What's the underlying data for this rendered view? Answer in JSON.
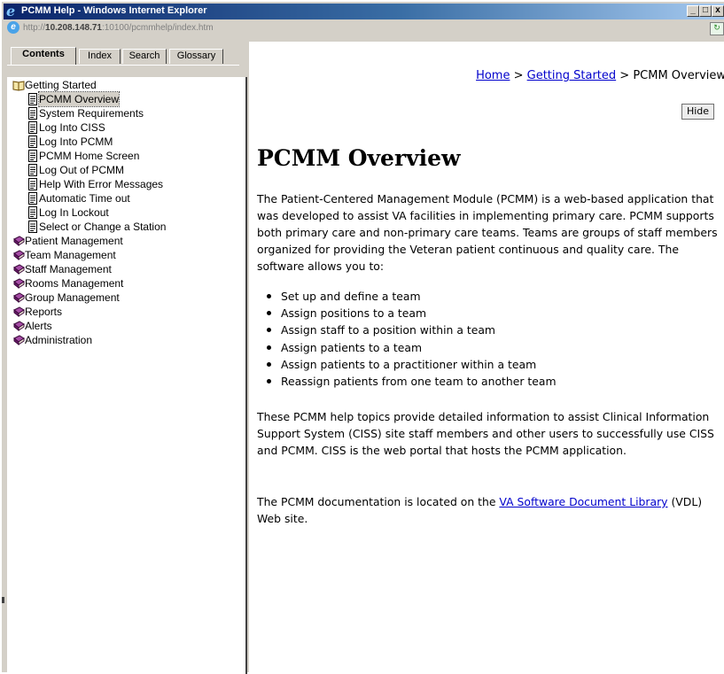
{
  "window": {
    "title": "PCMM Help - Windows Internet Explorer",
    "url_prefix": "http://",
    "url_host": "10.208.148.71",
    "url_rest": ":10100/pcmmhelp/index.htm",
    "minimize_glyph": "_",
    "maximize_glyph": "□",
    "close_glyph": "x"
  },
  "nav": {
    "tabs": [
      {
        "label": "Contents",
        "active": true
      },
      {
        "label": "Index"
      },
      {
        "label": "Search"
      },
      {
        "label": "Glossary"
      }
    ],
    "tree": [
      {
        "label": "Getting Started",
        "icon": "open-book-icon",
        "indent": 0
      },
      {
        "label": "PCMM Overview",
        "icon": "page-icon",
        "indent": 1,
        "selected": true
      },
      {
        "label": "System Requirements",
        "icon": "page-icon",
        "indent": 1
      },
      {
        "label": "Log Into CISS",
        "icon": "page-icon",
        "indent": 1
      },
      {
        "label": "Log Into PCMM",
        "icon": "page-icon",
        "indent": 1
      },
      {
        "label": "PCMM Home Screen",
        "icon": "page-icon",
        "indent": 1
      },
      {
        "label": "Log Out of PCMM",
        "icon": "page-icon",
        "indent": 1
      },
      {
        "label": "Help With Error Messages",
        "icon": "page-icon",
        "indent": 1
      },
      {
        "label": "Automatic Time out",
        "icon": "page-icon",
        "indent": 1
      },
      {
        "label": "Log In Lockout",
        "icon": "page-icon",
        "indent": 1
      },
      {
        "label": "Select or Change a Station",
        "icon": "page-icon",
        "indent": 1
      },
      {
        "label": "Patient Management",
        "icon": "closed-book-icon",
        "indent": 0
      },
      {
        "label": "Team Management",
        "icon": "closed-book-icon",
        "indent": 0
      },
      {
        "label": "Staff Management",
        "icon": "closed-book-icon",
        "indent": 0
      },
      {
        "label": "Rooms Management",
        "icon": "closed-book-icon",
        "indent": 0
      },
      {
        "label": "Group Management",
        "icon": "closed-book-icon",
        "indent": 0
      },
      {
        "label": "Reports",
        "icon": "closed-book-icon",
        "indent": 0
      },
      {
        "label": "Alerts",
        "icon": "closed-book-icon",
        "indent": 0
      },
      {
        "label": "Administration",
        "icon": "closed-book-icon",
        "indent": 0
      }
    ]
  },
  "content": {
    "breadcrumb": {
      "home": "Home",
      "sep1": " > ",
      "getting_started": "Getting Started",
      "sep2": " > ",
      "current": "PCMM Overview"
    },
    "hide_label": "Hide",
    "title": "PCMM Overview",
    "intro": "The Patient-Centered Management Module (PCMM) is a web-based application that was developed to assist VA facilities in implementing primary care. PCMM supports both primary care and non-primary care teams. Teams are groups of staff members organized for providing the Veteran patient continuous and quality care. The software allows you to:",
    "bullets": [
      "Set up and define a team",
      "Assign positions to a team",
      "Assign staff to a position within a team",
      "Assign patients to a team",
      "Assign patients to a practitioner within a team",
      "Reassign patients from one team to another team"
    ],
    "para2": "These PCMM help topics provide detailed information to assist Clinical Information Support System (CISS) site staff members and other users to successfully use CISS and PCMM. CISS is the web portal that hosts the PCMM application.",
    "para3_before": "The PCMM documentation is located on the ",
    "para3_link": "VA Software Document Library",
    "para3_after": " (VDL) Web site."
  }
}
